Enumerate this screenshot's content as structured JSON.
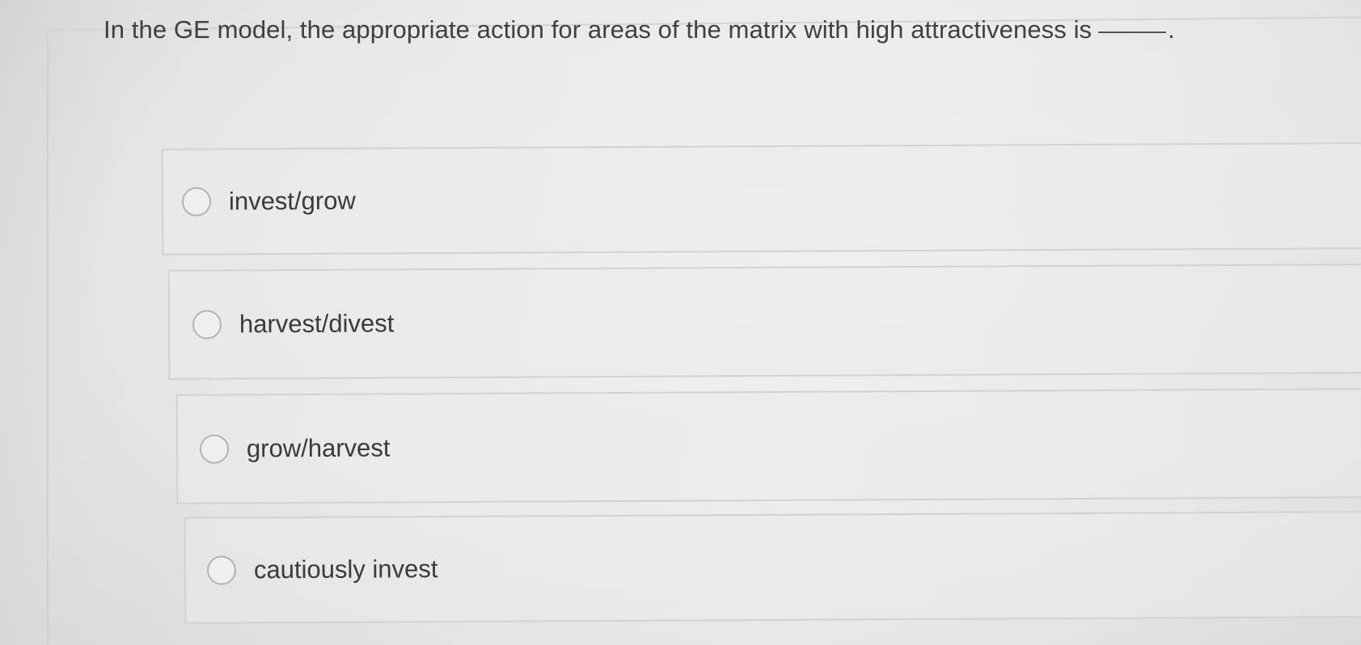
{
  "question": {
    "text": "In the GE model, the appropriate action for areas of the matrix with high attractiveness is",
    "period": "."
  },
  "options": [
    {
      "label": "invest/grow",
      "selected": false
    },
    {
      "label": "harvest/divest",
      "selected": false
    },
    {
      "label": "grow/harvest",
      "selected": false
    },
    {
      "label": "cautiously invest",
      "selected": false
    }
  ],
  "colors": {
    "background": "#e8e8e8",
    "text": "#3f3f3f",
    "border": "#d2d2d2",
    "radio_border": "#b3b3b3"
  }
}
